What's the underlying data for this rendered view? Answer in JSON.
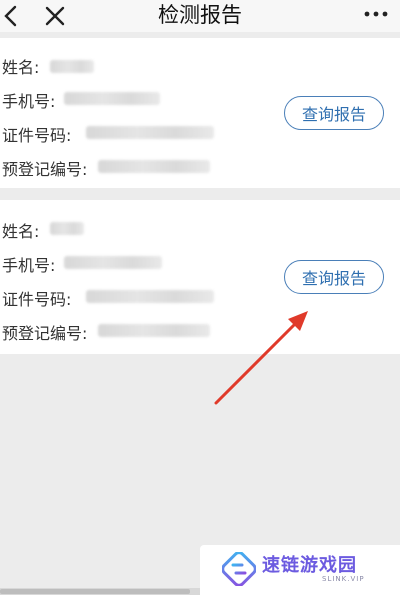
{
  "header": {
    "title": "检测报告",
    "back_icon": "chevron-left-icon",
    "close_icon": "close-icon",
    "more_icon": "more-horizontal-icon"
  },
  "records": [
    {
      "fields": [
        {
          "label": "姓名:",
          "value": ""
        },
        {
          "label": "手机号:",
          "value": ""
        },
        {
          "label": "证件号码:",
          "value": ""
        },
        {
          "label": "预登记编号:",
          "value": ""
        }
      ],
      "button_label": "查询报告"
    },
    {
      "fields": [
        {
          "label": "姓名:",
          "value": ""
        },
        {
          "label": "手机号:",
          "value": ""
        },
        {
          "label": "证件号码:",
          "value": ""
        },
        {
          "label": "预登记编号:",
          "value": ""
        }
      ],
      "button_label": "查询报告"
    }
  ],
  "watermark": {
    "name": "速链游戏园",
    "sub": "SLINK.VIP"
  },
  "colors": {
    "accent": "#2f6fb0",
    "annotation_arrow": "#e03a2a",
    "watermark": "#6c5be0"
  }
}
